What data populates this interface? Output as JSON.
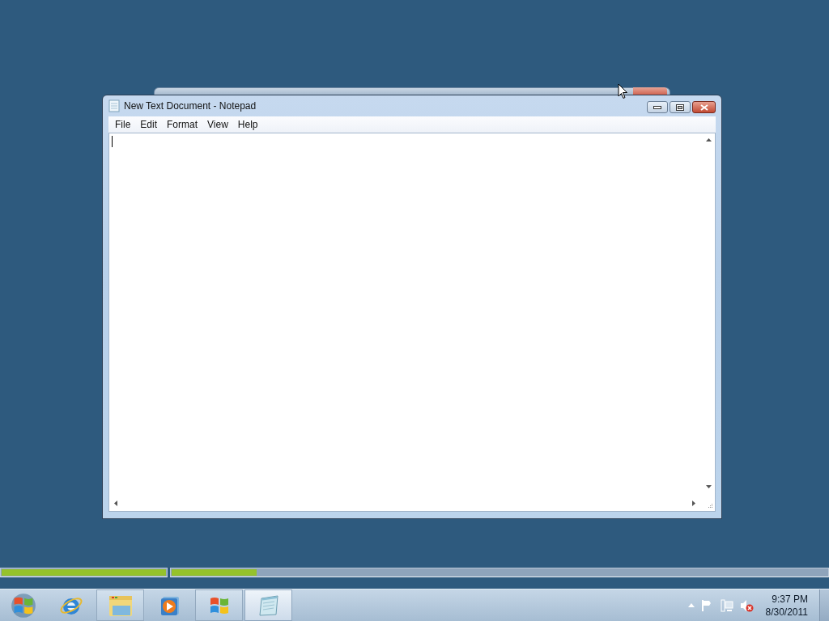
{
  "window": {
    "title": "New Text Document - Notepad",
    "menu": [
      {
        "label": "File"
      },
      {
        "label": "Edit"
      },
      {
        "label": "Format"
      },
      {
        "label": "View"
      },
      {
        "label": "Help"
      }
    ]
  },
  "progress": [
    {
      "level": 1
    },
    {
      "level": 0.13
    }
  ],
  "taskbar": {
    "buttons": [
      {
        "kind": "ie",
        "running": false,
        "selected": false
      },
      {
        "kind": "explorer",
        "running": true,
        "selected": false
      },
      {
        "kind": "media",
        "running": false,
        "selected": false
      },
      {
        "kind": "windows",
        "running": true,
        "selected": false
      },
      {
        "kind": "notepad",
        "running": true,
        "selected": true
      }
    ],
    "time": "9:37 PM",
    "date": "8/30/2011"
  }
}
